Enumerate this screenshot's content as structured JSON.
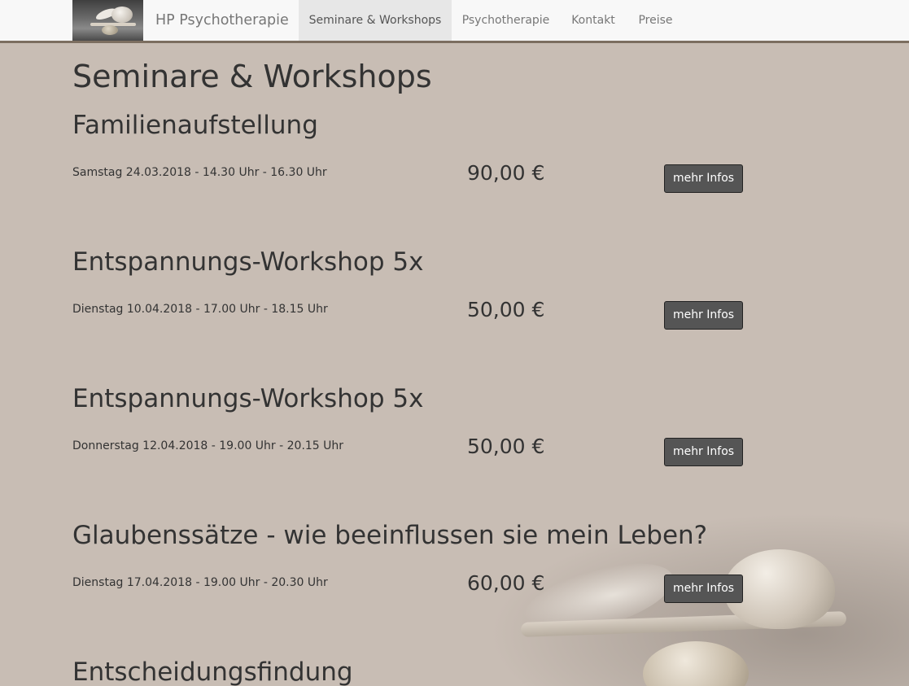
{
  "navbar": {
    "brand": "HP Psychotherapie",
    "items": [
      {
        "label": "Seminare & Workshops",
        "active": true
      },
      {
        "label": "Psychotherapie",
        "active": false
      },
      {
        "label": "Kontakt",
        "active": false
      },
      {
        "label": "Preise",
        "active": false
      }
    ]
  },
  "page": {
    "title": "Seminare & Workshops"
  },
  "events": [
    {
      "title": "Familienaufstellung",
      "date": "Samstag 24.03.2018 - 14.30 Uhr - 16.30 Uhr",
      "price": "90,00 €",
      "button_label": "mehr Infos"
    },
    {
      "title": "Entspannungs-Workshop 5x",
      "date": "Dienstag 10.04.2018 - 17.00 Uhr - 18.15 Uhr",
      "price": "50,00 €",
      "button_label": "mehr Infos"
    },
    {
      "title": "Entspannungs-Workshop 5x",
      "date": "Donnerstag 12.04.2018 - 19.00 Uhr - 20.15 Uhr",
      "price": "50,00 €",
      "button_label": "mehr Infos"
    },
    {
      "title": "Glaubenssätze - wie beeinflussen sie mein Leben?",
      "date": "Dienstag 17.04.2018 - 19.00 Uhr - 20.30 Uhr",
      "price": "60,00 €",
      "button_label": "mehr Infos"
    },
    {
      "title": "Entscheidungsfindung"
    }
  ],
  "colors": {
    "page_background": "#c8bdb4",
    "navbar_background": "#f8f8f8",
    "navbar_border": "#7c6e60",
    "nav_active_background": "#e7e7e7",
    "button_background": "#555555",
    "text": "#333333"
  }
}
